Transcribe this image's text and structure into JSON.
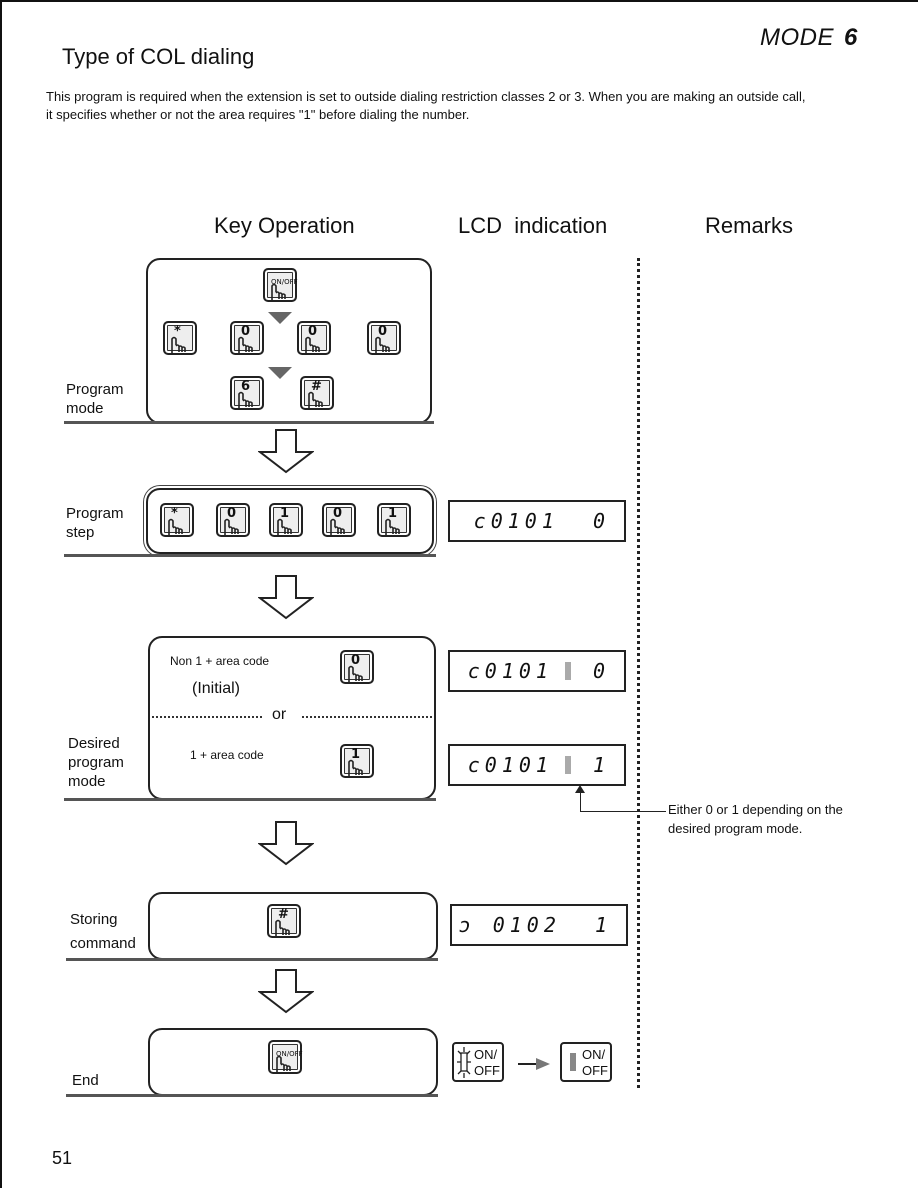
{
  "header": {
    "mode_label": "MODE",
    "mode_number": "6",
    "title": "Type of COL dialing",
    "intro_line1": "This program is required when the extension is set to outside dialing restriction classes 2 or 3. When you are making an outside call,",
    "intro_line2": "it specifies whether or not the area requires \"1\" before dialing the number."
  },
  "columns": {
    "key_operation": "Key Operation",
    "lcd_indication": "LCD  indication",
    "remarks": "Remarks"
  },
  "steps": {
    "program_mode": {
      "label_line1": "Program",
      "label_line2": "mode",
      "keys_row1": [
        "ON/OFF"
      ],
      "keys_row2": [
        "*",
        "0",
        "0",
        "0"
      ],
      "keys_row3": [
        "6",
        "#"
      ]
    },
    "program_step": {
      "label_line1": "Program",
      "label_line2": "step",
      "keys": [
        "*",
        "0",
        "1",
        "0",
        "1"
      ],
      "lcd": "c0101  0"
    },
    "desired_program_mode": {
      "label_line1": "Desired",
      "label_line2": "program",
      "label_line3": "mode",
      "option1_text": "Non 1 + area code",
      "option1_note": "(Initial)",
      "option1_key": "0",
      "separator": "or",
      "option2_text": "1 + area code",
      "option2_key": "1",
      "lcd_option1_prefix": "c0101",
      "lcd_option1_value": "0",
      "lcd_option2_prefix": "c0101",
      "lcd_option2_value": "1"
    },
    "storing_command": {
      "label_line1": "Storing",
      "label_line2": "command",
      "key": "#",
      "lcd": "ɔ 0102  1"
    },
    "end": {
      "label": "End",
      "key": "ON/OFF",
      "indicator_before": "ON/\nOFF",
      "indicator_after": "ON/\nOFF",
      "indicator_before_l1": "ON/",
      "indicator_before_l2": "OFF",
      "indicator_after_l1": "ON/",
      "indicator_after_l2": "OFF"
    }
  },
  "remarks": {
    "note_line1": "Either 0 or 1 depending on the",
    "note_line2": "desired program mode."
  },
  "footer": {
    "page_number": "51"
  }
}
